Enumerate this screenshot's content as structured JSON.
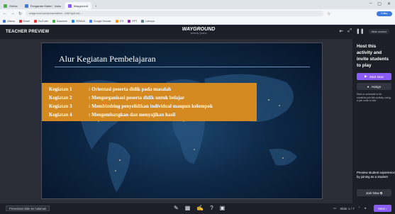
{
  "browser": {
    "tabs": [
      {
        "label": "Gdrive",
        "color": "#4caf50"
      },
      {
        "label": "Pengantar Materi · Insta",
        "color": "#3b7bdc"
      },
      {
        "label": "Wayground",
        "color": "#8a5cf6"
      }
    ],
    "address": "wayground.com/presentation/.../edit?pptLink=...",
    "profile_label": "Editor",
    "bookmarks": [
      "Utama",
      "Email",
      "YouTube",
      "Dokumen",
      "SEMUA",
      "Google Scholar",
      "ITS",
      "PPT",
      "Lainnya"
    ]
  },
  "app": {
    "mode_label": "TEACHER PREVIEW",
    "logo_title": "WAYGROUND",
    "logo_sub": "formerly Quizizz",
    "collapse_label": "Hide screen"
  },
  "slide": {
    "title": "Alur Kegiatan Pembelajaran",
    "rows": [
      {
        "key": "Kegiatan 1",
        "text": ": Orientasi peserta didik pada masalah"
      },
      {
        "key": "Kegiatan 2",
        "text": ": Mengorganisasi peserta didik untuk belajar"
      },
      {
        "key": "Kegiatan 3",
        "text": ": Membimbing penyelidikan individual maupun kelompok"
      },
      {
        "key": "Kegiatan 4",
        "text": ": Mengembangkan dan menyajikan hasil"
      }
    ]
  },
  "sidebar": {
    "host_text": "Host this activity and invite students to play",
    "start_now": "Start Now",
    "assign": "Assign",
    "note": "Start or schedule to let students join this activity, using a join code or link",
    "preview_text": "Preview student experience by joining as a student",
    "join_now": "Join Now"
  },
  "bottom": {
    "hide_label": "Presentasi slide ke halaman",
    "slide_counter": "Slide 1 / 7",
    "next_label": "Next"
  },
  "colors": {
    "accent": "#8a5cf6",
    "orange": "#d48a21",
    "bg": "#15171c"
  }
}
